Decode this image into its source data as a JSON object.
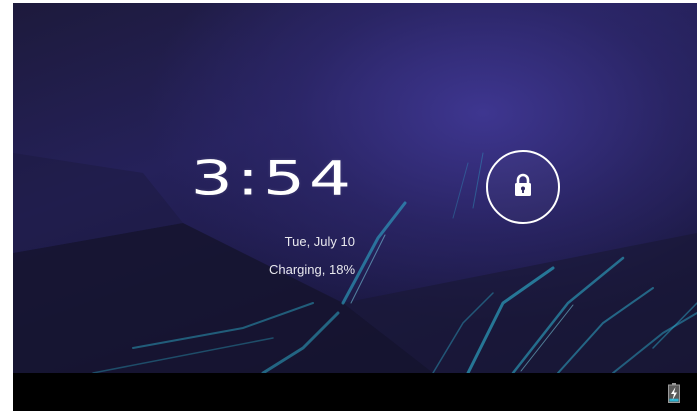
{
  "lockscreen": {
    "time": "3:54",
    "date": "Tue, July 10",
    "charging_status": "Charging, 18%",
    "unlock_icon": "lock-icon"
  },
  "status_bar": {
    "battery_icon": "battery-charging-icon",
    "battery_level": 0.18
  },
  "colors": {
    "wallpaper_dark": "#1d1a3c",
    "wallpaper_glow": "#3e3690",
    "accent_cyan": "#2fb6d4",
    "text": "#ffffff"
  }
}
